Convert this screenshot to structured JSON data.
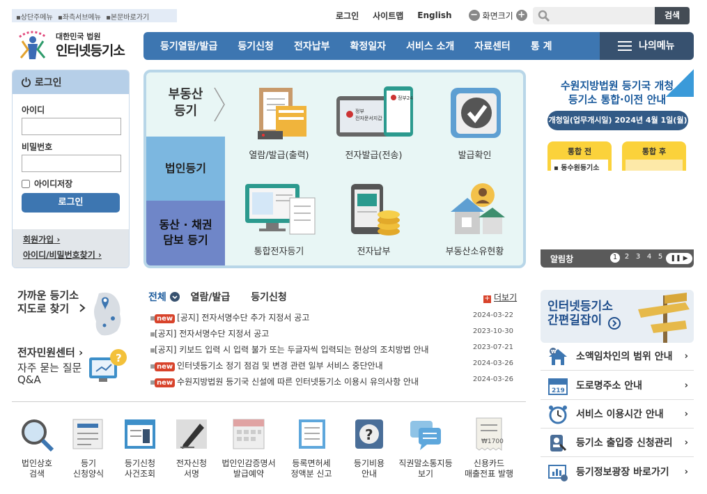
{
  "skip_links": [
    "▪상단주메뉴",
    "▪좌측서브메뉴",
    "▪본문바로가기"
  ],
  "top_links": {
    "login": "로그인",
    "sitemap": "사이트맵",
    "english": "English",
    "zoom": "화면크기"
  },
  "search": {
    "placeholder": "",
    "button": "검색"
  },
  "logo": {
    "small": "대한민국 법원",
    "big": "인터넷등기소"
  },
  "nav": [
    "등기열람/발급",
    "등기신청",
    "전자납부",
    "확정일자",
    "서비스 소개",
    "자료센터",
    "통 계"
  ],
  "my_menu": "나의메뉴",
  "login_box": {
    "title": "로그인",
    "id_label": "아이디",
    "pw_label": "비밀번호",
    "save_id": "아이디저장",
    "button": "로그인",
    "signup": "회원가입",
    "find": "아이디/비밀번호찾기"
  },
  "panel": {
    "side": [
      "부동산\n등기",
      "법인등기",
      "동산 · 채권\n담보 등기"
    ],
    "items": [
      "열람/발급(출력)",
      "전자발급(전송)",
      "발급확인",
      "통합전자등기",
      "전자납부",
      "부동산소유현황"
    ],
    "device_text": "전자문서지갑",
    "gov24": "정부24"
  },
  "banner": {
    "title": "수원지방법원 등기국 개청\n등기소 통합·이전 안내",
    "sub": "개청일(업무개시일) 2024년 4월 1일(월)",
    "before": "통합 전",
    "after": "통합 후",
    "before_item": "▪ 동수원등기소"
  },
  "alim": {
    "label": "알림창",
    "pages": [
      "1",
      "2",
      "3",
      "4",
      "5"
    ]
  },
  "left_lower": {
    "nearby": "가까운 등기소\n지도로 찾기",
    "civil": "전자민원센터",
    "faq": "자주 묻는 질문\nQ&A"
  },
  "notice_tabs": [
    "전체",
    "열람/발급",
    "등기신청"
  ],
  "more": "더보기",
  "notices": [
    {
      "new": true,
      "text": "[공지] 전자서명수단 추가 지정서 공고",
      "date": "2024-03-22"
    },
    {
      "new": false,
      "text": "[공지] 전자서명수단 지정서 공고",
      "date": "2023-10-30"
    },
    {
      "new": false,
      "text": "[공지] 키보드 입력 시 입력 불가 또는 두글자씩 입력되는 현상의 조치방법 안내",
      "date": "2023-07-21"
    },
    {
      "new": true,
      "text": "인터넷등기소 정기 점검 및 변경 관련 일부 서비스 중단안내",
      "date": "2024-03-26"
    },
    {
      "new": true,
      "text": "수원지방법원 등기국 신설에 따른 인터넷등기소 이용시 유의사항 안내",
      "date": "2024-03-26"
    }
  ],
  "new_badge": "new",
  "quick": [
    "법인상호\n검색",
    "등기\n신청양식",
    "등기신청\n사건조회",
    "전자신청\n서명",
    "법인인감증명서\n발급예약",
    "등록면허세\n정액분 신고",
    "등기비용\n안내",
    "직권말소통지등\n보기",
    "신용카드\n매출전표 발행"
  ],
  "easy": "인터넷등기소\n간편길잡이",
  "right_links": [
    "소액임차인의 범위 안내",
    "도로명주소 안내",
    "서비스 이용시간 안내",
    "등기소 출입증 신청관리",
    "등기정보광장 바로가기"
  ],
  "road_sign": "219",
  "colors": {
    "nav": "#3d76b1",
    "mymenu": "#37516f",
    "accent_blue": "#1a5a9c",
    "new_badge": "#d8432b"
  }
}
